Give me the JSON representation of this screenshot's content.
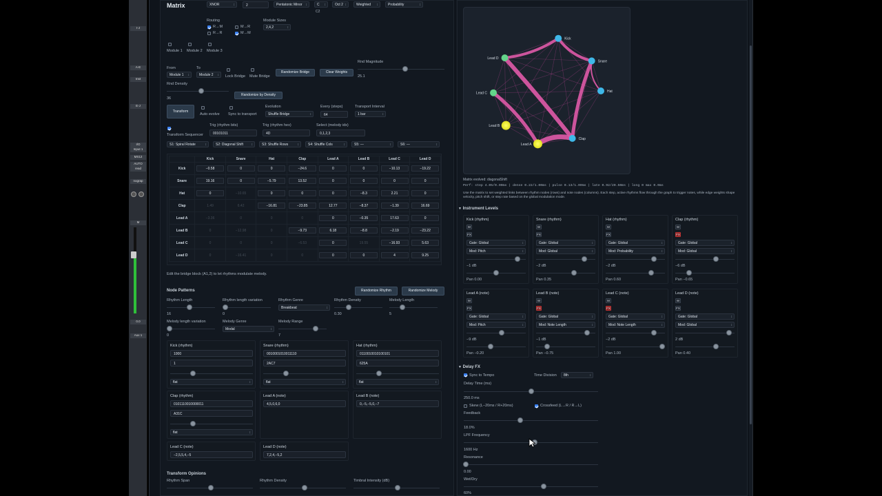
{
  "daw": {
    "labels": [
      "I-J",
      "A-E",
      "Inst",
      "E-J",
      "I/O",
      "Input 1",
      "MS12",
      "AUTO",
      "read",
      "nograp",
      "M",
      "0.0",
      "Aux 1"
    ]
  },
  "header": {
    "title": "Matrix",
    "logic_value": "XNOR",
    "rule_value": "2",
    "scale_value": "Pentatonic Minor",
    "key_value": "C",
    "octave_value": "Oct 2",
    "mode1_value": "Weighted",
    "mode2_value": "Probability",
    "key_hint": "C2"
  },
  "routing": {
    "label": "Routing",
    "r_m": "R→M",
    "r_r": "R→R",
    "m_r": "M→R",
    "m_m": "M→M",
    "module_size_label": "Module Sizes",
    "module_size_value": "2,4,2"
  },
  "modules": [
    "Module 1",
    "Module 2",
    "Module 3"
  ],
  "bridge": {
    "from_label": "From",
    "to_label": "To",
    "from_value": "Module 1",
    "to_value": "Module 2",
    "lock": "Lock Bridge",
    "mute": "Mute Bridge",
    "randomize": "Randomize Bridge",
    "clear": "Clear Weights",
    "rnd_mag_label": "Rnd Magnitude",
    "rnd_mag_value": "25.1",
    "rnd_density_label": "Rnd Density",
    "rnd_density_value": "36",
    "randomize_density": "Randomize by Density"
  },
  "transform": {
    "button": "Transform",
    "auto_evolve": "Auto evolve",
    "sync": "Sync to transport",
    "evolution_label": "Evolution",
    "evolution_value": "Shuffle Bridge",
    "every_label": "Every (steps)",
    "every_value": "64",
    "interval_label": "Transport Interval",
    "interval_value": "1 bar",
    "seq_label": "Transform Sequencer",
    "trig_bits_label": "Trig (rhythm bits)",
    "trig_bits_value": "00101011",
    "trig_hex_label": "Trig (rhythm hex)",
    "trig_hex_value": "4D",
    "select_label": "Select (melody idx)",
    "select_value": "0,1,2,3",
    "slots": [
      "S1: Spiral Rotate",
      "S2: Diagonal Shift",
      "S3: Shuffle Rows",
      "S4: Shuffle Cols",
      "S5: —",
      "S6: —"
    ]
  },
  "matrix": {
    "cols": [
      "Kick",
      "Snare",
      "Hat",
      "Clap",
      "Lead A",
      "Lead B",
      "Lead C",
      "Lead D"
    ],
    "rows": [
      {
        "name": "Kick",
        "cells": [
          "−0.58",
          "0",
          "0",
          "−24.6",
          "0",
          "0",
          "−10.13",
          "−19.22"
        ]
      },
      {
        "name": "Snare",
        "cells": [
          "19.16",
          "0",
          "−5.79",
          "13.52",
          "0",
          "0",
          "0",
          "0"
        ]
      },
      {
        "name": "Hat",
        "cells": [
          "0",
          "−10.65",
          "0",
          "0",
          "0",
          "−8.3",
          "2.21",
          "0"
        ]
      },
      {
        "name": "Clap",
        "cells": [
          "1.49",
          "6.42",
          "−16.81",
          "−23.85",
          "12.77",
          "−8.37",
          "−1.39",
          "16.69"
        ]
      },
      {
        "name": "Lead A",
        "cells": [
          "−3.36",
          "0",
          "0",
          "0",
          "0",
          "−0.35",
          "17.63",
          "0"
        ]
      },
      {
        "name": "Lead B",
        "cells": [
          "0",
          "−12.98",
          "0",
          "−9.73",
          "6.18",
          "−8.8",
          "−2.19",
          "−23.22"
        ]
      },
      {
        "name": "Lead C",
        "cells": [
          "0",
          "0",
          "0",
          "−6.53",
          "0",
          "19.55",
          "−16.93",
          "5.63"
        ]
      },
      {
        "name": "Lead D",
        "cells": [
          "0",
          "−16.41",
          "0",
          "0",
          "0",
          "0",
          "4",
          "9.25"
        ]
      }
    ],
    "hint": "Edit the bridge block (A1,2) to let rhythms modulate melody."
  },
  "nodes": {
    "title": "Node Patterns",
    "rand_rhythm": "Randomize Rhythm",
    "rand_melody": "Randomize Melody",
    "rhythm_length": "Rhythm Length",
    "rhythm_length_v": "16",
    "rhythm_len_var": "Rhythm length variation",
    "rhythm_len_var_v": "0",
    "rhythm_genre": "Rhythm Genre",
    "rhythm_genre_v": "Breakbeat",
    "rhythm_density": "Rhythm Density",
    "rhythm_density_v": "0.30",
    "melody_length": "Melody Length",
    "melody_length_v": "5",
    "melody_len_var": "Melody length variation",
    "melody_len_var_v": "0",
    "melody_genre": "Melody Genre",
    "melody_genre_v": "Modal",
    "melody_range": "Melody Range",
    "melody_range_v": "7",
    "cards": [
      {
        "title": "Kick (rhythm)",
        "bits": "1000",
        "hex": "1",
        "shape": "flat"
      },
      {
        "title": "Snare (rhythm)",
        "bits": "0010001010011110",
        "hex": "2AC7",
        "shape": "flat"
      },
      {
        "title": "Hat (rhythm)",
        "bits": "0110010010100101",
        "hex": "625A",
        "shape": "flat"
      },
      {
        "title": "Clap (rhythm)",
        "bits": "0101110010000011",
        "hex": "A31C",
        "shape": "flat"
      },
      {
        "title": "Lead A (note)",
        "bits": "4,5,0,6,0"
      },
      {
        "title": "Lead B (note)",
        "bits": "0,−5,−5,0,−7"
      },
      {
        "title": "Lead C (note)",
        "bits": "−2,5,5,4,−5"
      },
      {
        "title": "Lead D (note)",
        "bits": "7,2,4,−5,2"
      }
    ]
  },
  "opinions": {
    "title": "Transform Opinions",
    "a": "Rhythm Span",
    "b": "Rhythm Density",
    "c": "Timbral Intensity (dB)"
  },
  "graph": {
    "status": "Matrix evolved: diagonalShift",
    "perf": "Perf: step 4.05/0.00ms | dense 0.22/1.00ms | pulse 0.13/1.00ms | late 0.92/20.50ms | long 0 max 0.0ms",
    "help": "Use the matrix to set weighted links between rhythm nodes (rows) and note nodes (columns). Each step, active rhythms flow through the graph to trigger notes, while edge weights shape velocity, pitch shift, or step rate based on the global modulation mode.",
    "labels": [
      "Kick",
      "Snare",
      "Hat",
      "Clap",
      "Lead A",
      "Lead B",
      "Lead C",
      "Lead D"
    ]
  },
  "instruments": {
    "title": "Instrument Levels",
    "items": [
      {
        "name": "Kick (rhythm)",
        "gate": "Gate: Global",
        "mod": "Mod: Pitch",
        "db": "−1 dB",
        "pan": "Pan 0.00",
        "fx_red": false,
        "vol": 0.9,
        "panv": 0.5
      },
      {
        "name": "Snare (rhythm)",
        "gate": "Gate: Global",
        "mod": "Mod: Global",
        "db": "−2 dB",
        "pan": "Pan 0.35",
        "fx_red": false,
        "vol": 0.85,
        "panv": 0.65
      },
      {
        "name": "Hat (rhythm)",
        "gate": "Gate: Global",
        "mod": "Mod: Probability",
        "db": "−2 dB",
        "pan": "Pan 0.60",
        "fx_red": false,
        "vol": 0.85,
        "panv": 0.8
      },
      {
        "name": "Clap (rhythm)",
        "gate": "Gate: Global",
        "mod": "Mod: Global",
        "db": "−6 dB",
        "pan": "Pan −0.65",
        "fx_red": true,
        "vol": 0.7,
        "panv": 0.2
      },
      {
        "name": "Lead A (note)",
        "gate": "Gate: Global",
        "mod": "Mod: Pitch",
        "db": "−9 dB",
        "pan": "Pan −0.20",
        "fx_red": false,
        "vol": 0.6,
        "panv": 0.4
      },
      {
        "name": "Lead B (note)",
        "gate": "Gate: Global",
        "mod": "Mod: Note Length",
        "db": "−1 dB",
        "pan": "Pan −0.75",
        "fx_red": true,
        "vol": 0.9,
        "panv": 0.15
      },
      {
        "name": "Lead C (note)",
        "gate": "Gate: Global",
        "mod": "Mod: Note Length",
        "db": "−2 dB",
        "pan": "Pan 1.00",
        "fx_red": true,
        "vol": 0.85,
        "panv": 1.0
      },
      {
        "name": "Lead D (note)",
        "gate": "Gate: Global",
        "mod": "Mod: Global",
        "db": "2 dB",
        "pan": "Pan 0.40",
        "fx_red": false,
        "vol": 0.95,
        "panv": 0.7
      }
    ],
    "m": "M",
    "fx": "FX"
  },
  "delay": {
    "title": "Delay FX",
    "sync": "Sync to Tempo",
    "division_label": "Time Division",
    "division_value": "8th",
    "time_label": "Delay Time (ms)",
    "time_value": "250.0 ms",
    "skew": "Skew (L−20ms / R+20ms)",
    "crossfeed": "Crossfeed (L→R / R→L)",
    "feedback_label": "Feedback",
    "feedback_value": "18.0%",
    "lpf_label": "LPF Frequency",
    "lpf_value": "1600 Hz",
    "res_label": "Resonance",
    "res_value": "0.00",
    "wet_label": "Wet/Dry",
    "wet_value": "60%"
  }
}
